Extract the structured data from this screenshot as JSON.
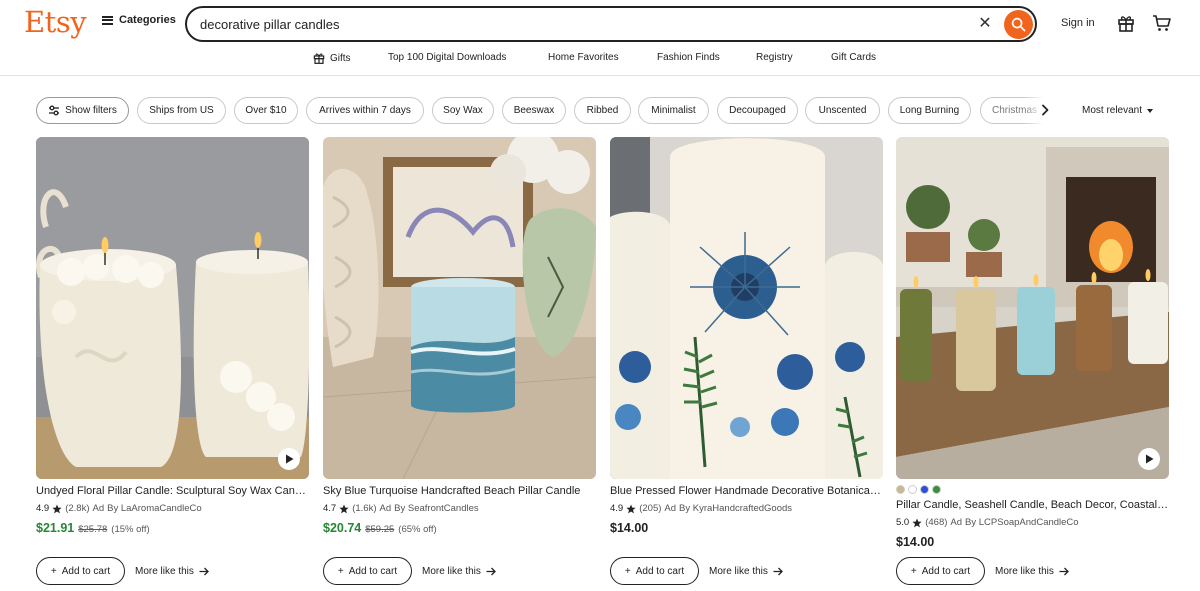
{
  "brand": {
    "logo_text": "Etsy",
    "accent_color": "#f1641e"
  },
  "header": {
    "categories_label": "Categories",
    "search_value": "decorative pillar candles",
    "signin_label": "Sign in"
  },
  "nav": [
    "Gifts",
    "Top 100 Digital Downloads",
    "Home Favorites",
    "Fashion Finds",
    "Registry",
    "Gift Cards"
  ],
  "filters": {
    "show_filters_label": "Show filters",
    "chips": [
      "Ships from US",
      "Over $10",
      "Arrives within 7 days",
      "Soy Wax",
      "Beeswax",
      "Ribbed",
      "Minimalist",
      "Decoupaged",
      "Unscented",
      "Long Burning",
      "Christmas"
    ],
    "sort_label": "Most relevant"
  },
  "listings": [
    {
      "title": "Undyed Floral Pillar Candle: Sculptural Soy Wax Candle",
      "rating": "4.9",
      "reviews": "(2.8k)",
      "ad": "Ad",
      "seller": "By LaAromaCandleCo",
      "price": "$21.91",
      "original_price": "$25.78",
      "discount": "(15% off)",
      "has_video": true,
      "add_to_cart": "Add to cart",
      "more_like": "More like this"
    },
    {
      "title": "Sky Blue Turquoise Handcrafted Beach Pillar Candle",
      "rating": "4.7",
      "reviews": "(1.6k)",
      "ad": "Ad",
      "seller": "By SeafrontCandles",
      "price": "$20.74",
      "original_price": "$59.25",
      "discount": "(65% off)",
      "has_video": false,
      "add_to_cart": "Add to cart",
      "more_like": "More like this"
    },
    {
      "title": "Blue Pressed Flower Handmade Decorative Botanical Candle",
      "rating": "4.9",
      "reviews": "(205)",
      "ad": "Ad",
      "seller": "By KyraHandcraftedGoods",
      "price": "$14.00",
      "has_video": false,
      "add_to_cart": "Add to cart",
      "more_like": "More like this"
    },
    {
      "title": "Pillar Candle, Seashell Candle, Beach Decor, Coastal Decor",
      "rating": "5.0",
      "reviews": "(468)",
      "ad": "Ad",
      "seller": "By LCPSoapAndCandleCo",
      "price": "$14.00",
      "has_video": true,
      "swatches": [
        "#c9b88a",
        "#ffffff",
        "#2b4fd8",
        "#3a8f3a"
      ],
      "add_to_cart": "Add to cart",
      "more_like": "More like this"
    }
  ]
}
